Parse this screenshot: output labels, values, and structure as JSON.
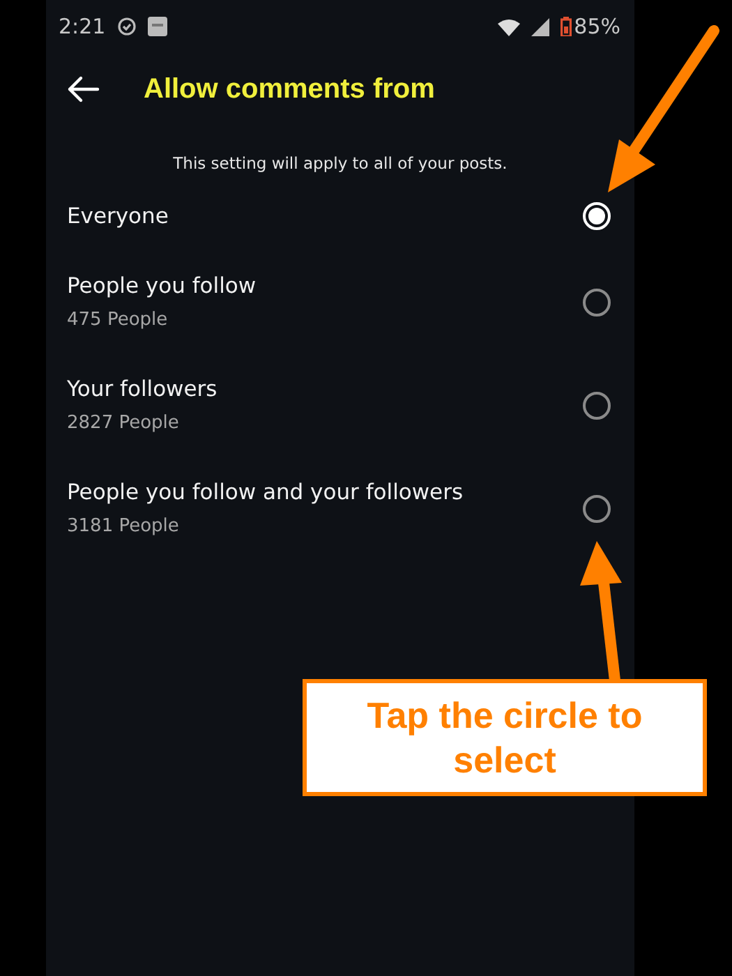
{
  "status_bar": {
    "time": "2:21",
    "battery": "85%"
  },
  "header": {
    "title": "Allow comments from"
  },
  "note": "This setting will apply to all of your posts.",
  "options": [
    {
      "label": "Everyone",
      "selected": true
    },
    {
      "label": "People you follow",
      "count": "475 People",
      "selected": false
    },
    {
      "label": "Your followers",
      "count": "2827 People",
      "selected": false
    },
    {
      "label": "People you follow and your followers",
      "count": "3181 People",
      "selected": false
    }
  ],
  "annotation": {
    "callout": "Tap the circle to select"
  }
}
